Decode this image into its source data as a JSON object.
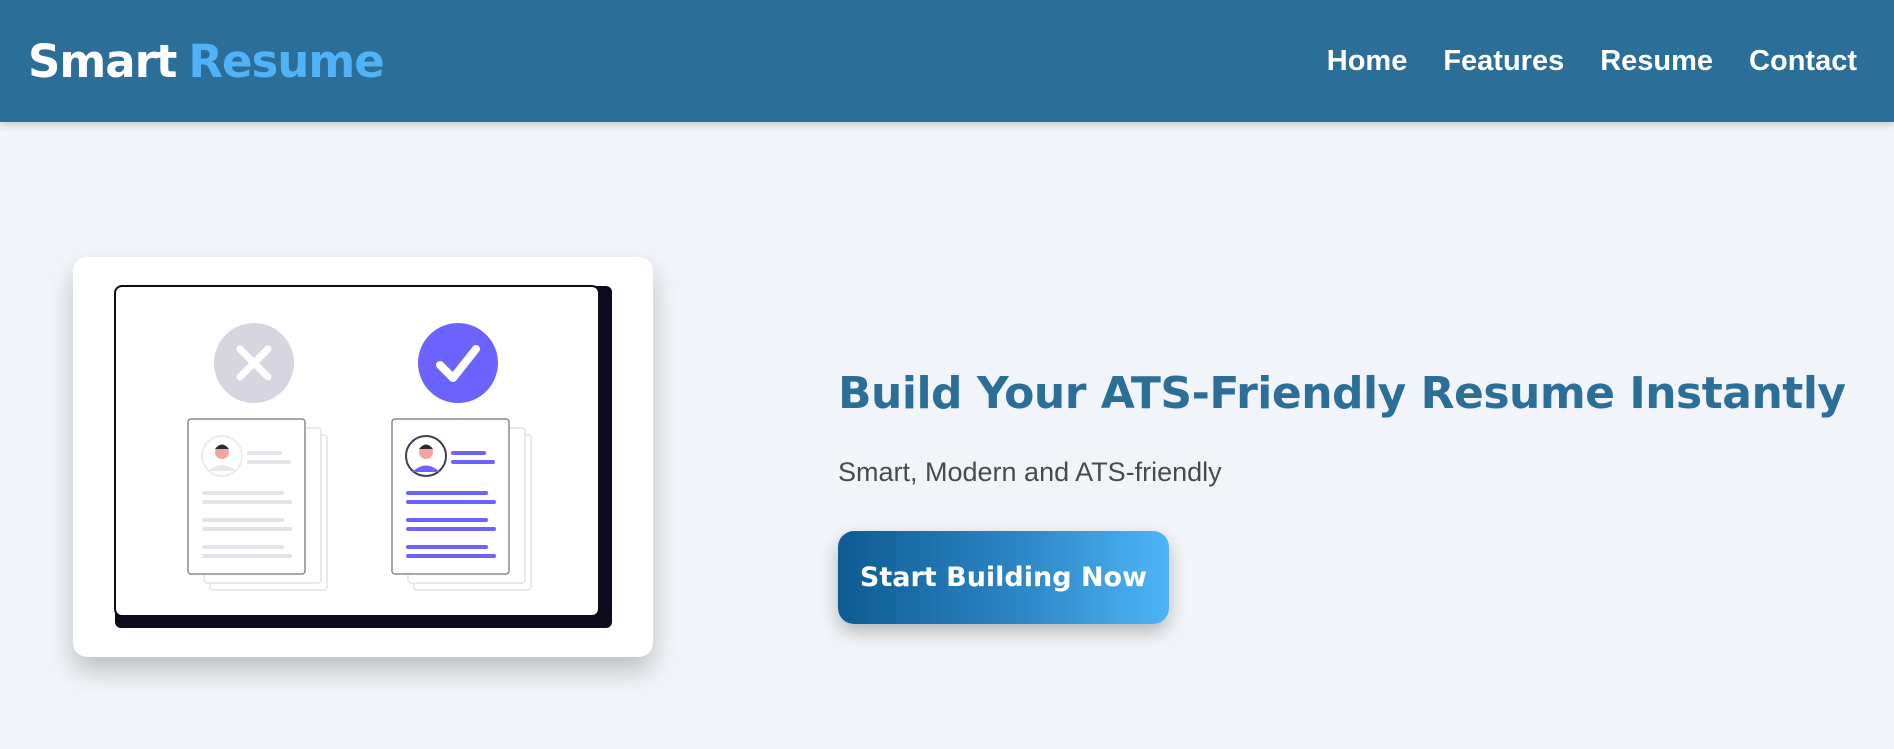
{
  "brand": {
    "part1": "Smart",
    "part2": "Resume"
  },
  "nav": {
    "items": [
      {
        "label": "Home"
      },
      {
        "label": "Features"
      },
      {
        "label": "Resume"
      },
      {
        "label": "Contact"
      }
    ]
  },
  "hero": {
    "title": "Build Your ATS-Friendly Resume Instantly",
    "subtitle": "Smart, Modern and ATS-friendly",
    "cta_label": "Start Building Now"
  },
  "illustration": {
    "reject_icon": "x-icon",
    "approve_icon": "check-icon"
  },
  "colors": {
    "header_bg": "#2b6f98",
    "brand_accent": "#4fb3f6",
    "page_bg": "#f1f5f9",
    "title": "#2b6f98",
    "accent_purple": "#6c63ff",
    "reject_gray": "#d6d5e0"
  }
}
